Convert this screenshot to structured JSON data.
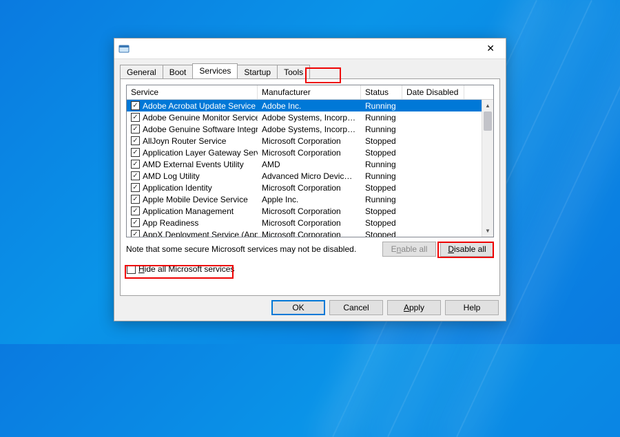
{
  "tabs": {
    "general": "General",
    "boot": "Boot",
    "services": "Services",
    "startup": "Startup",
    "tools": "Tools"
  },
  "columns": {
    "service": "Service",
    "manufacturer": "Manufacturer",
    "status": "Status",
    "date_disabled": "Date Disabled"
  },
  "rows": [
    {
      "checked": true,
      "selected": true,
      "service": "Adobe Acrobat Update Service",
      "manufacturer": "Adobe Inc.",
      "status": "Running",
      "date_disabled": ""
    },
    {
      "checked": true,
      "selected": false,
      "service": "Adobe Genuine Monitor Service",
      "manufacturer": "Adobe Systems, Incorpora...",
      "status": "Running",
      "date_disabled": ""
    },
    {
      "checked": true,
      "selected": false,
      "service": "Adobe Genuine Software Integri...",
      "manufacturer": "Adobe Systems, Incorpora...",
      "status": "Running",
      "date_disabled": ""
    },
    {
      "checked": true,
      "selected": false,
      "service": "AllJoyn Router Service",
      "manufacturer": "Microsoft Corporation",
      "status": "Stopped",
      "date_disabled": ""
    },
    {
      "checked": true,
      "selected": false,
      "service": "Application Layer Gateway Service",
      "manufacturer": "Microsoft Corporation",
      "status": "Stopped",
      "date_disabled": ""
    },
    {
      "checked": true,
      "selected": false,
      "service": "AMD External Events Utility",
      "manufacturer": "AMD",
      "status": "Running",
      "date_disabled": ""
    },
    {
      "checked": true,
      "selected": false,
      "service": "AMD Log Utility",
      "manufacturer": "Advanced Micro Devices, I...",
      "status": "Running",
      "date_disabled": ""
    },
    {
      "checked": true,
      "selected": false,
      "service": "Application Identity",
      "manufacturer": "Microsoft Corporation",
      "status": "Stopped",
      "date_disabled": ""
    },
    {
      "checked": true,
      "selected": false,
      "service": "Apple Mobile Device Service",
      "manufacturer": "Apple Inc.",
      "status": "Running",
      "date_disabled": ""
    },
    {
      "checked": true,
      "selected": false,
      "service": "Application Management",
      "manufacturer": "Microsoft Corporation",
      "status": "Stopped",
      "date_disabled": ""
    },
    {
      "checked": true,
      "selected": false,
      "service": "App Readiness",
      "manufacturer": "Microsoft Corporation",
      "status": "Stopped",
      "date_disabled": ""
    },
    {
      "checked": true,
      "selected": false,
      "service": "AppX Deployment Service (AppX...",
      "manufacturer": "Microsoft Corporation",
      "status": "Stopped",
      "date_disabled": ""
    }
  ],
  "note_text": "Note that some secure Microsoft services may not be disabled.",
  "buttons": {
    "enable_all_pre": "E",
    "enable_all_u": "n",
    "enable_all_post": "able all",
    "disable_all_pre": "",
    "disable_all_u": "D",
    "disable_all_post": "isable all",
    "ok": "OK",
    "cancel": "Cancel",
    "apply_pre": "",
    "apply_u": "A",
    "apply_post": "pply",
    "help": "Help"
  },
  "hide_checkbox": {
    "pre": "",
    "u": "H",
    "post": "ide all Microsoft services"
  }
}
